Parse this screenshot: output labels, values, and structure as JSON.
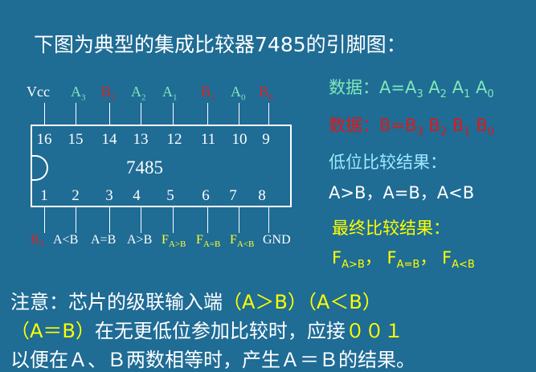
{
  "title": "下图为典型的集成比较器7485的引脚图：",
  "chip": {
    "name": "7485",
    "top_pin_numbers": [
      "16",
      "15",
      "14",
      "13",
      "12",
      "11",
      "10",
      "9"
    ],
    "bottom_pin_numbers": [
      "1",
      "2",
      "3",
      "4",
      "5",
      "6",
      "7",
      "8"
    ],
    "top_labels": {
      "vcc": "Vcc",
      "a3": {
        "base": "A",
        "sub": "3"
      },
      "b2": {
        "base": "B",
        "sub": "2"
      },
      "a2": {
        "base": "A",
        "sub": "2"
      },
      "a1": {
        "base": "A",
        "sub": "1"
      },
      "b1": {
        "base": "B",
        "sub": "1"
      },
      "a0": {
        "base": "A",
        "sub": "0"
      },
      "b0": {
        "base": "B",
        "sub": "0"
      }
    },
    "bottom_labels": {
      "b3": {
        "base": "B",
        "sub": "3"
      },
      "a_lt_b": "A<B",
      "a_eq_b": "A=B",
      "a_gt_b": "A>B",
      "f_gt": {
        "base": "F",
        "sub": "A>B"
      },
      "f_eq": {
        "base": "F",
        "sub": "A=B"
      },
      "f_lt": {
        "base": "F",
        "sub": "A<B"
      },
      "gnd": "GND"
    }
  },
  "right_panel": {
    "data_label_1": "数据：",
    "data_a": {
      "prefix": "A=A",
      "s3": "3",
      "a": "A",
      "s2": "2",
      "a1": "A",
      "s1": "1",
      "a0": "A",
      "s0": "0"
    },
    "data_label_2": "数据：",
    "data_b": {
      "prefix": "B=B",
      "s3": "3",
      "b": "B",
      "s2": "2",
      "b1": "B",
      "s1": "1",
      "b0": "B",
      "s0": "0"
    },
    "low_result_title": "低位比较结果：",
    "low_result_values": "A>B，A=B，A<B",
    "final_result_title": "最终比较结果：",
    "final_results": [
      {
        "base": "F",
        "sub": "A>B",
        "sep": "，"
      },
      {
        "base": "F",
        "sub": "A=B",
        "sep": "，"
      },
      {
        "base": "F",
        "sub": "A<B",
        "sep": ""
      }
    ]
  },
  "note": {
    "line1_a": "注意：芯片的级联输入端",
    "line1_b": "（A＞B）（A＜B）",
    "line2_a": "（A＝B）",
    "line2_b": "在无更低位参加比较时，应接",
    "line2_c": "００１",
    "line3": "以便在Ａ、Ｂ两数相等时，产生Ａ＝Ｂ的结果。"
  },
  "colors": {
    "background": "#1f6c95",
    "green": "#7fe8b8",
    "red": "#e01818",
    "yellow": "#ffff00",
    "cyan": "#9fe8ff",
    "white": "#ffffff"
  }
}
